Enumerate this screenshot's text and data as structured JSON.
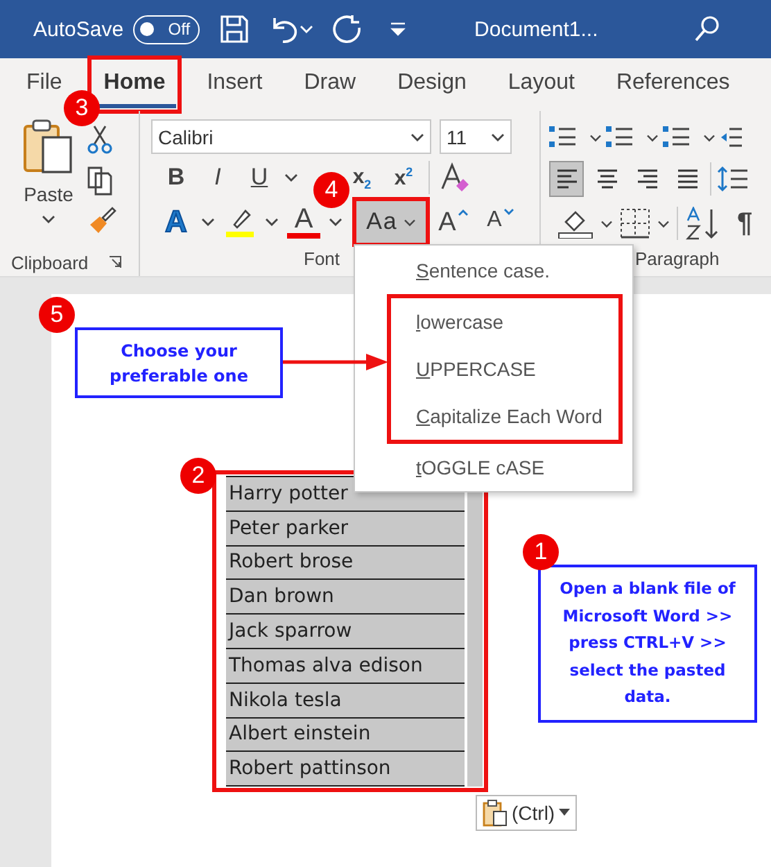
{
  "title_bar": {
    "autosave_label": "AutoSave",
    "autosave_toggle": {
      "label": "Off",
      "on": false
    },
    "document_title": "Document1..."
  },
  "tabs": [
    {
      "label": "File",
      "selected": false
    },
    {
      "label": "Home",
      "selected": true
    },
    {
      "label": "Insert",
      "selected": false
    },
    {
      "label": "Draw",
      "selected": false
    },
    {
      "label": "Design",
      "selected": false
    },
    {
      "label": "Layout",
      "selected": false
    },
    {
      "label": "References",
      "selected": false
    }
  ],
  "ribbon": {
    "clipboard": {
      "paste_label": "Paste",
      "group_label": "Clipboard"
    },
    "font": {
      "font_name": "Calibri",
      "font_size": "11",
      "bold": "B",
      "italic": "I",
      "underline": "U",
      "subscript": "x",
      "subscript_mark": "2",
      "superscript": "x",
      "superscript_mark": "2",
      "text_effects": "A",
      "font_color": "A",
      "change_case": "Aa",
      "grow": "A",
      "shrink": "A",
      "group_label": "Font"
    },
    "paragraph": {
      "alignment": [
        {
          "kind": "left",
          "selected": true
        },
        {
          "kind": "center",
          "selected": false
        },
        {
          "kind": "right",
          "selected": false
        },
        {
          "kind": "justify",
          "selected": false
        }
      ],
      "pilcrow": "¶",
      "group_label": "Paragraph"
    }
  },
  "change_case_menu": [
    {
      "label": "Sentence case.",
      "framed": false
    },
    {
      "label": "lowercase",
      "framed": true
    },
    {
      "label": "UPPERCASE",
      "framed": true
    },
    {
      "label": "Capitalize Each Word",
      "framed": true
    },
    {
      "label": "tOGGLE cASE",
      "framed": false
    }
  ],
  "table": {
    "rows": [
      "Harry potter",
      "Peter parker",
      "Robert brose",
      "Dan brown",
      "Jack sparrow",
      "Thomas alva edison",
      "Nikola tesla",
      "Albert einstein",
      "Robert pattinson"
    ]
  },
  "paste_options": {
    "label": "(Ctrl)"
  },
  "steps": [
    {
      "number": "3",
      "kind": "tab"
    },
    {
      "number": "4",
      "kind": "change_case"
    },
    {
      "number": "5",
      "kind": "menu_note",
      "note": "Choose your preferable one"
    },
    {
      "number": "2",
      "kind": "table"
    },
    {
      "number": "1",
      "kind": "start_note",
      "note": "Open a blank file of Microsoft Word >> press CTRL+V >> select the pasted data."
    }
  ]
}
